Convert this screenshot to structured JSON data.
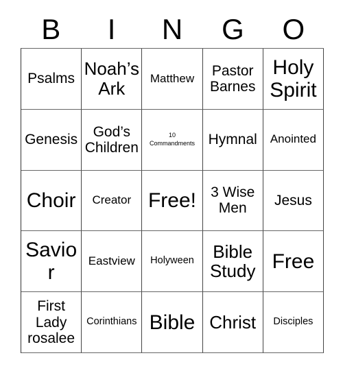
{
  "header": {
    "letters": [
      "B",
      "I",
      "N",
      "G",
      "O"
    ]
  },
  "grid": {
    "columns": 5,
    "rows": 5,
    "cells": [
      [
        {
          "text": "Psalms",
          "size": "md"
        },
        {
          "text": "Noah’s\nArk",
          "size": "lg"
        },
        {
          "text": "Matthew",
          "size": "sm"
        },
        {
          "text": "Pastor\nBarnes",
          "size": "md"
        },
        {
          "text": "Holy\nSpirit",
          "size": "xl"
        }
      ],
      [
        {
          "text": "Genesis",
          "size": "md"
        },
        {
          "text": "God’s\nChildren",
          "size": "md"
        },
        {
          "text": "10\nCommandments",
          "size": "xxs"
        },
        {
          "text": "Hymnal",
          "size": "md"
        },
        {
          "text": "Anointed",
          "size": "sm"
        }
      ],
      [
        {
          "text": "Choir",
          "size": "xl"
        },
        {
          "text": "Creator",
          "size": "sm"
        },
        {
          "text": "Free!",
          "size": "xl"
        },
        {
          "text": "3 Wise\nMen",
          "size": "md"
        },
        {
          "text": "Jesus",
          "size": "md"
        }
      ],
      [
        {
          "text": "Savior",
          "size": "xl"
        },
        {
          "text": "Eastview",
          "size": "sm"
        },
        {
          "text": "Holyween",
          "size": "xs"
        },
        {
          "text": "Bible\nStudy",
          "size": "lg"
        },
        {
          "text": "Free",
          "size": "xl"
        }
      ],
      [
        {
          "text": "First\nLady\nrosalee",
          "size": "md"
        },
        {
          "text": "Corinthians",
          "size": "xs"
        },
        {
          "text": "Bible",
          "size": "xl"
        },
        {
          "text": "Christ",
          "size": "lg"
        },
        {
          "text": "Disciples",
          "size": "xs"
        }
      ]
    ]
  },
  "colors": {
    "background": "#ffffff",
    "text": "#000000",
    "grid_line": "#555555"
  }
}
